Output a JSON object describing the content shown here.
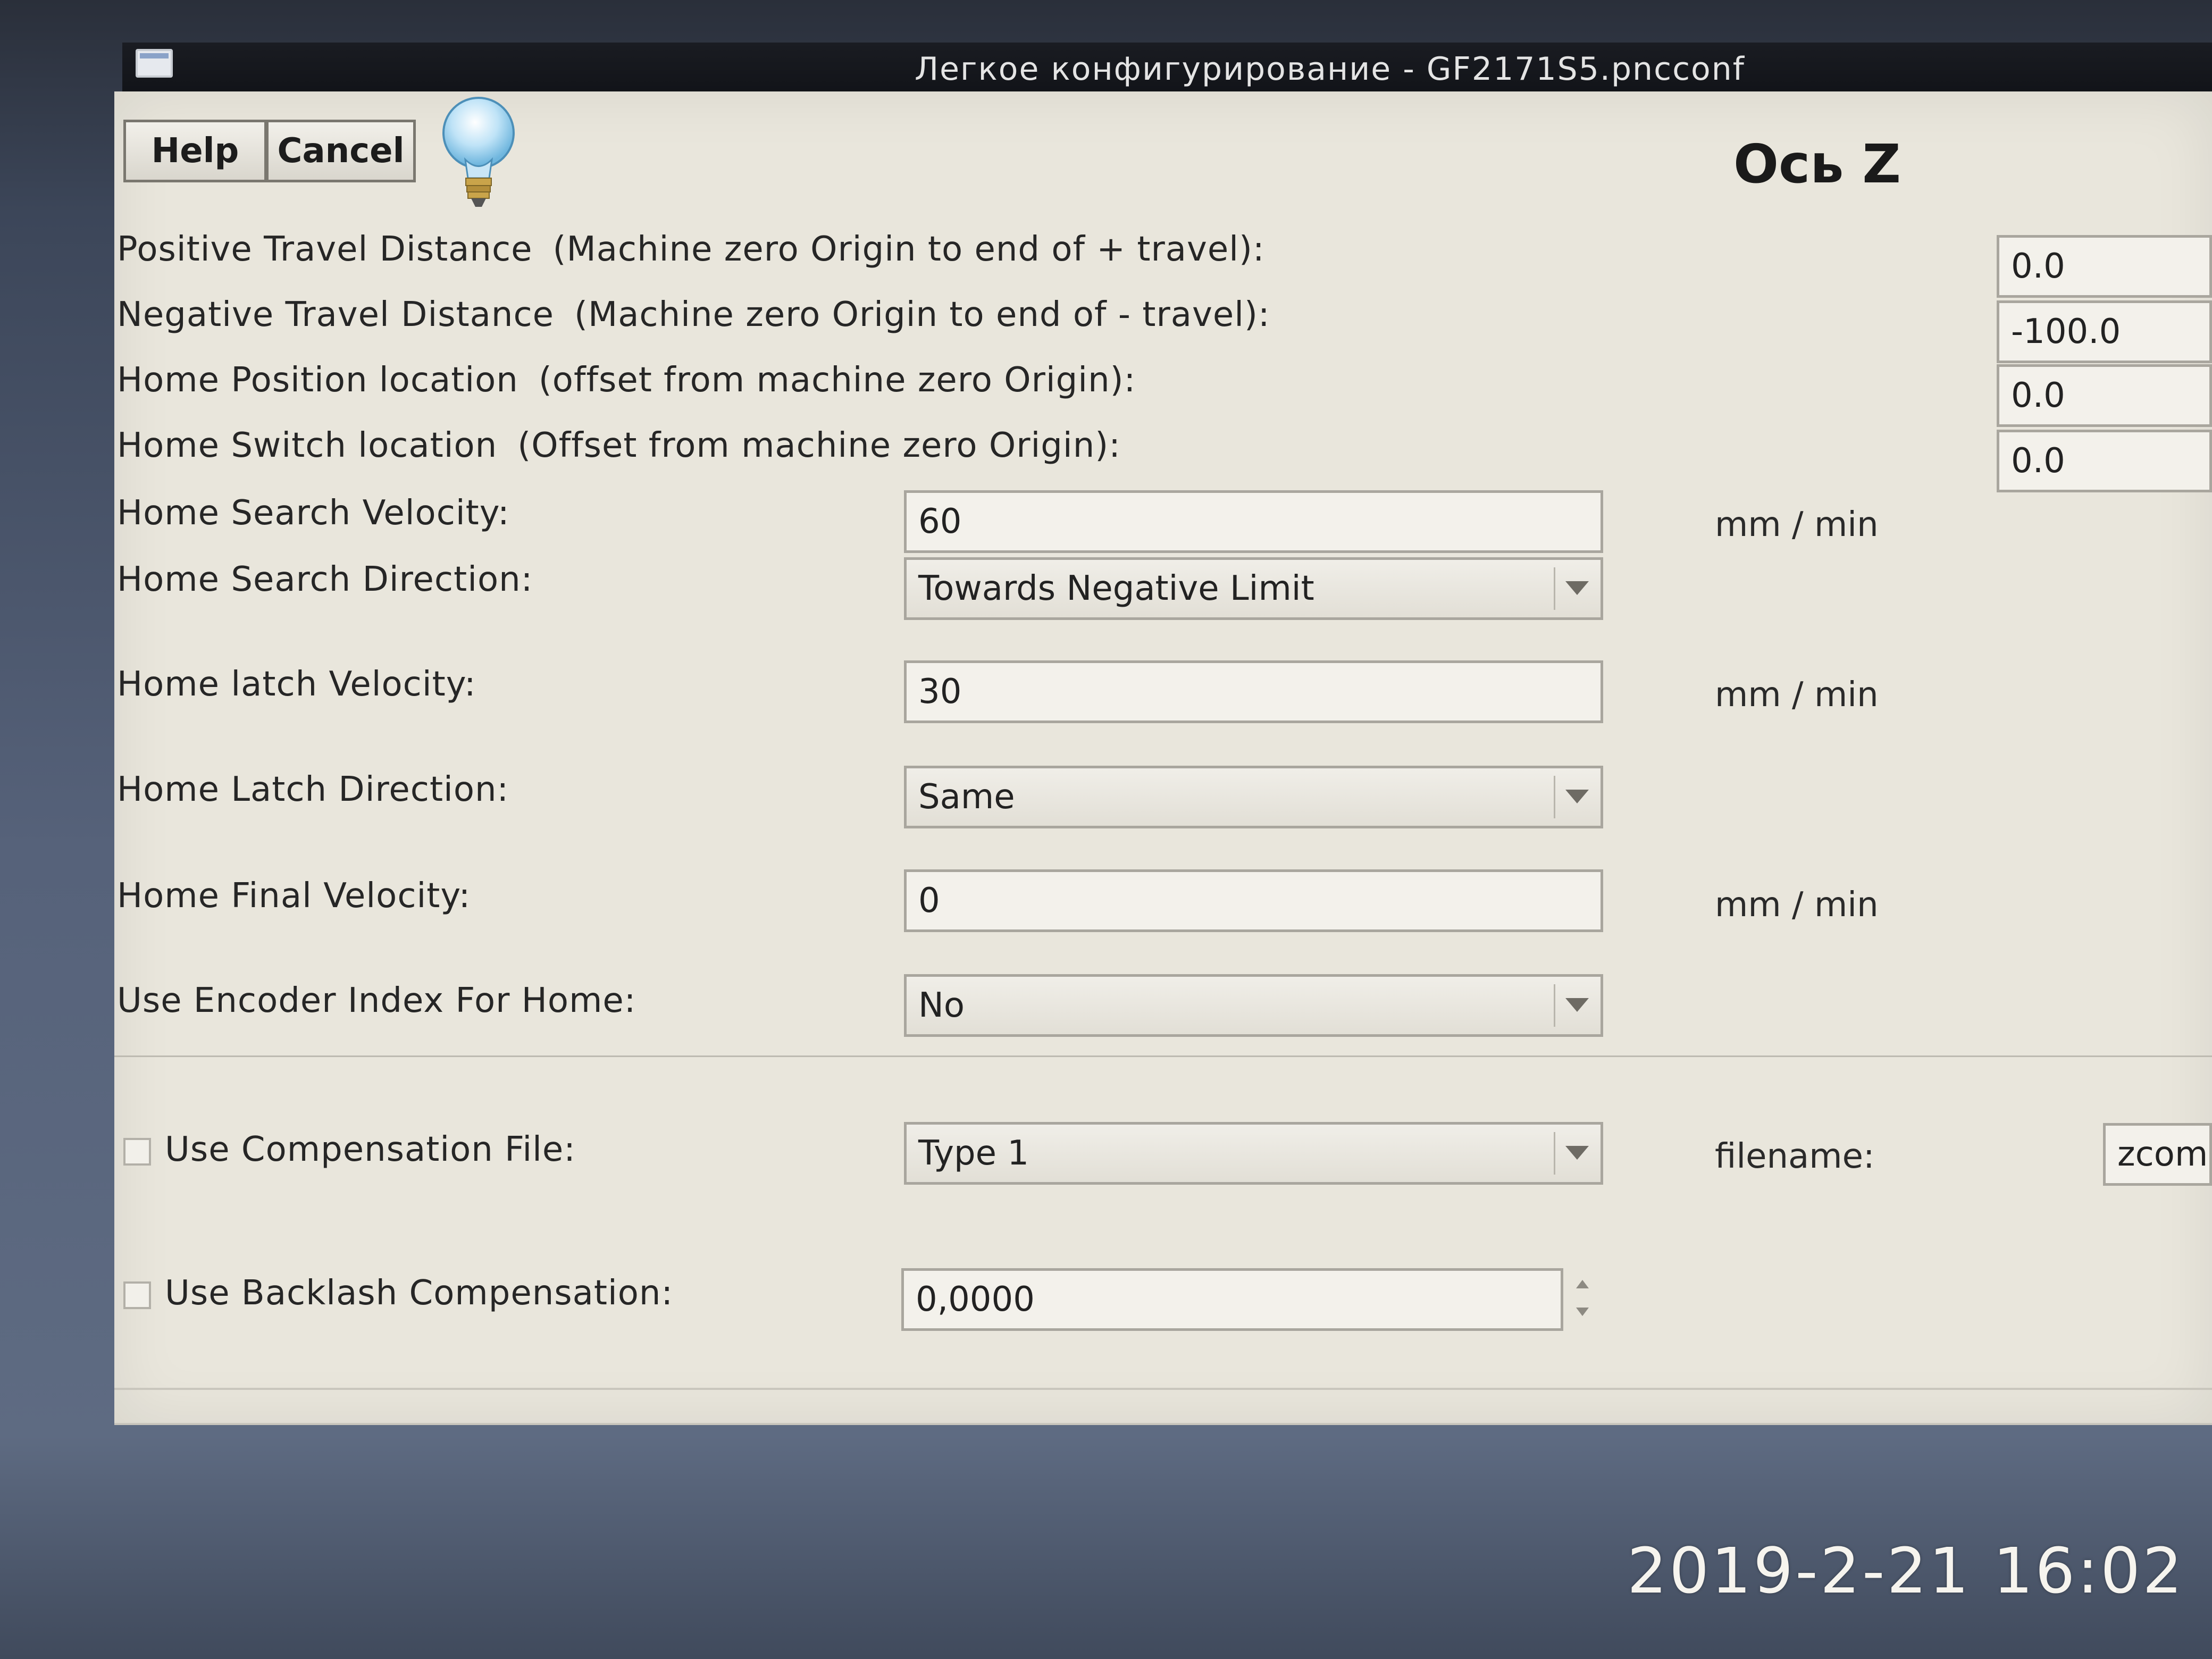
{
  "window": {
    "title": "Легкое конфигурирование - GF2171S5.pncconf"
  },
  "toolbar": {
    "help_label": "Help",
    "cancel_label": "Cancel"
  },
  "page": {
    "heading": "Ось Z"
  },
  "travel": {
    "positive_label": "Positive Travel Distance",
    "positive_desc": "(Machine zero Origin to end of + travel):",
    "positive_value": "0.0",
    "negative_label": "Negative Travel Distance",
    "negative_desc": "(Machine zero Origin to end of - travel):",
    "negative_value": "-100.0",
    "home_pos_label": "Home Position location",
    "home_pos_desc": "(offset from machine zero Origin):",
    "home_pos_value": "0.0",
    "home_switch_label": "Home Switch location",
    "home_switch_desc": "(Offset from machine zero Origin):",
    "home_switch_value": "0.0"
  },
  "homing": {
    "search_velocity_label": "Home Search Velocity:",
    "search_velocity_value": "60",
    "search_velocity_unit": "mm / min",
    "search_direction_label": "Home Search Direction:",
    "search_direction_value": "Towards Negative Limit",
    "latch_velocity_label": "Home latch Velocity:",
    "latch_velocity_value": "30",
    "latch_velocity_unit": "mm / min",
    "latch_direction_label": "Home Latch Direction:",
    "latch_direction_value": "Same",
    "final_velocity_label": "Home Final Velocity:",
    "final_velocity_value": "0",
    "final_velocity_unit": "mm / min",
    "encoder_index_label": "Use Encoder Index For Home:",
    "encoder_index_value": "No"
  },
  "compensation": {
    "file_label": "Use Compensation File:",
    "file_checked": false,
    "type_value": "Type 1",
    "filename_label": "filename:",
    "filename_value": "zcomp",
    "backlash_label": "Use Backlash Compensation:",
    "backlash_checked": false,
    "backlash_value": "0,0000"
  },
  "overlay": {
    "timestamp": "2019-2-21  16:02"
  }
}
